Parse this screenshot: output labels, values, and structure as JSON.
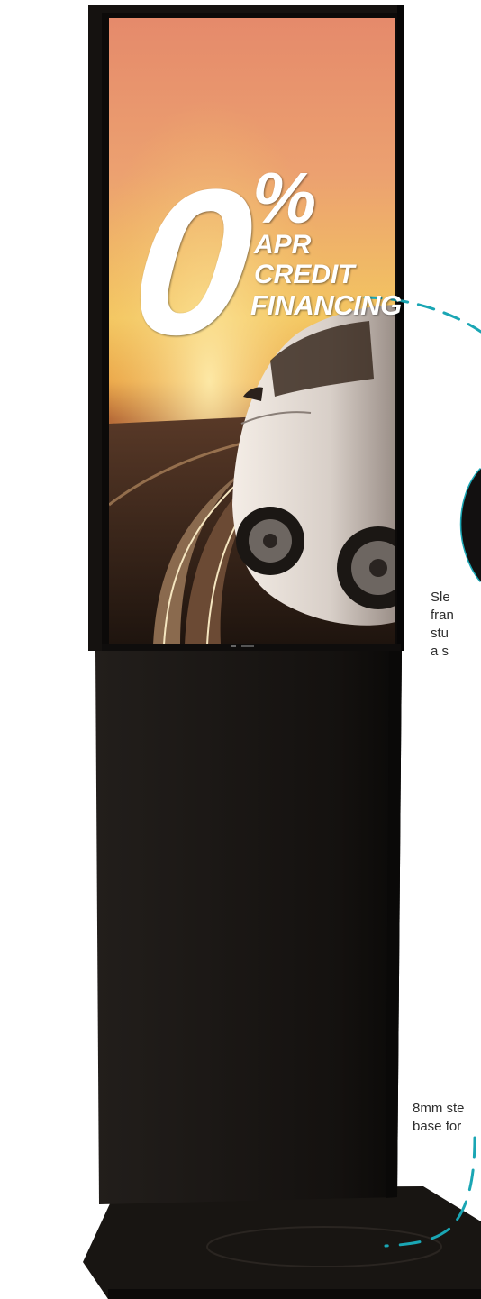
{
  "advert": {
    "zero": "0",
    "percent": "%",
    "line1": "APR",
    "line2": "CREDIT",
    "line3": "FINANCING"
  },
  "callouts": {
    "frame": [
      "Sle",
      "fran",
      "stu",
      "a s"
    ],
    "base": [
      "8mm ste",
      "base for"
    ]
  },
  "colors": {
    "accent_dashed": "#1aa6b4",
    "kiosk_body": "#141210",
    "screen_sky_top": "#e88d6a",
    "screen_sun": "#f2c15a"
  }
}
